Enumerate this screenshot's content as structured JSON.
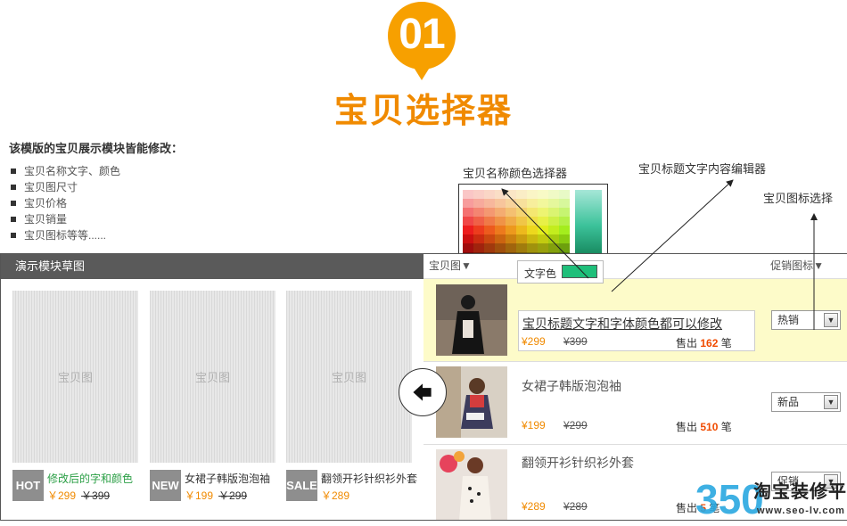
{
  "header": {
    "badge_number": "01",
    "title": "宝贝选择器"
  },
  "intro": {
    "title": "该模版的宝贝展示模块皆能修改：",
    "features": [
      "宝贝名称文字、颜色",
      "宝贝图尺寸",
      "宝贝价格",
      "宝贝销量",
      "宝贝图标等等......"
    ]
  },
  "annotations": {
    "color_picker": "宝贝名称颜色选择器",
    "title_editor": "宝贝标题文字内容编辑器",
    "icon_select": "宝贝图标选择"
  },
  "color_chip": {
    "label": "文字色",
    "color": "#1fbf7a"
  },
  "demo_panel": {
    "title": "演示模块草图",
    "image_placeholder": "宝贝图",
    "cards": [
      {
        "badge": "HOT",
        "name": "修改后的字和颜色",
        "price": "￥299",
        "old_price": "￥399",
        "name_color": "#2b9f46"
      },
      {
        "badge": "NEW",
        "name": "女裙子韩版泡泡袖",
        "price": "￥199",
        "old_price": "￥299"
      },
      {
        "badge": "SALE",
        "name": "翻领开衫针织衫外套",
        "price": "￥289"
      }
    ]
  },
  "editor_panel": {
    "header_left": "宝贝图▼",
    "header_right": "促销图标▼",
    "rows": [
      {
        "title": "宝贝标题文字和字体颜色都可以修改",
        "price": "¥299",
        "old_price": "¥399",
        "sold_label": "售出",
        "sold": "162",
        "sold_unit": "笔",
        "icon": "热销"
      },
      {
        "title": "女裙子韩版泡泡袖",
        "price": "¥199",
        "old_price": "¥299",
        "sold_label": "售出",
        "sold": "510",
        "sold_unit": "笔",
        "icon": "新品"
      },
      {
        "title": "翻领开衫针织衫外套",
        "price": "¥289",
        "old_price": "¥289",
        "sold_label": "售出",
        "sold": "5",
        "sold_unit": "笔",
        "icon": "促销"
      }
    ]
  },
  "watermark": {
    "logo": "350",
    "text": "淘宝装修平台",
    "url": "www.seo-lv.com"
  },
  "colors": {
    "accent": "#f08a00",
    "highlight_row": "#fdfbc9",
    "panel_header": "#5a5a5a"
  }
}
